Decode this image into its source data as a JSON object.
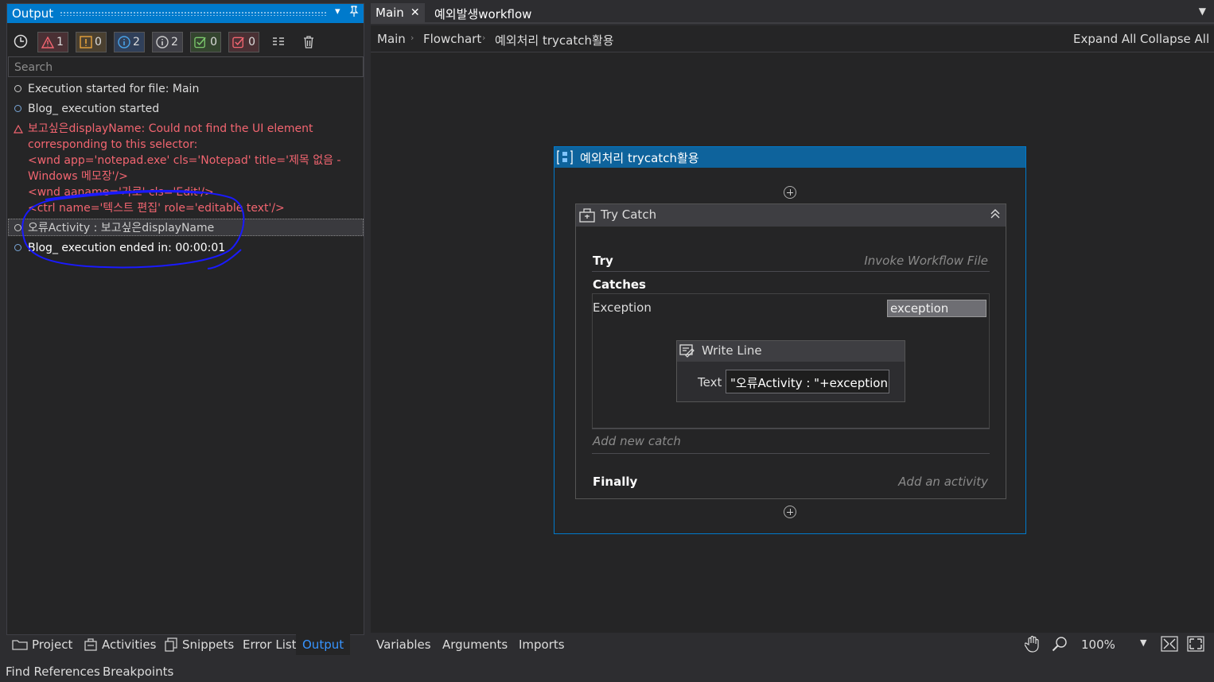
{
  "output_panel": {
    "title": "Output",
    "filters": [
      {
        "name": "warning-filter",
        "count": "1"
      },
      {
        "name": "error-filter",
        "count": "0"
      },
      {
        "name": "info-filter",
        "count": "2"
      },
      {
        "name": "trace-filter",
        "count": "2"
      },
      {
        "name": "verbose-filter",
        "count": "0"
      },
      {
        "name": "critical-filter",
        "count": "0"
      }
    ],
    "search_placeholder": "Search",
    "log": [
      {
        "type": "info",
        "text": "Execution started for file: Main"
      },
      {
        "type": "info",
        "text": "Blog_ execution started"
      },
      {
        "type": "error",
        "lines": [
          "보고싶은displayName: Could not find the UI element",
          "corresponding to this selector:",
          "<wnd app='notepad.exe' cls='Notepad' title='제목 없음 -",
          "Windows 메모장'/>",
          "<wnd aaname='가로' cls='Edit'/>",
          "<ctrl name='텍스트 편집' role='editable text'/>"
        ]
      },
      {
        "type": "trace",
        "text": "오류Activity : 보고싶은displayName"
      },
      {
        "type": "info",
        "text": "Blog_ execution ended in: 00:00:01"
      }
    ]
  },
  "bottom_tabs": [
    "Project",
    "Activities",
    "Snippets",
    "Error List",
    "Output"
  ],
  "bottom_tabs_row2": [
    "Find References",
    "Breakpoints"
  ],
  "doc_tabs": {
    "main": "Main",
    "second": "예외발생workflow"
  },
  "breadcrumb": [
    "Main",
    "Flowchart",
    "예외처리 trycatch활용"
  ],
  "expand_all": "Expand All",
  "collapse_all": "Collapse All",
  "sequence": {
    "title": "예외처리 trycatch활용",
    "try_catch": {
      "title": "Try Catch",
      "try_label": "Try",
      "try_activity": "Invoke Workflow File",
      "catches_label": "Catches",
      "exception_type": "Exception",
      "exception_var": "exception",
      "write_line": {
        "title": "Write Line",
        "text_label": "Text",
        "text_value": "\"오류Activity : \"+exception.S"
      },
      "add_new_catch": "Add new catch",
      "finally_label": "Finally",
      "finally_hint": "Add an activity"
    }
  },
  "designer_bar": {
    "variables": "Variables",
    "arguments": "Arguments",
    "imports": "Imports",
    "zoom": "100%"
  },
  "colors": {
    "accent": "#007acc",
    "error": "#f26570",
    "annotation": "#1a1aff"
  }
}
